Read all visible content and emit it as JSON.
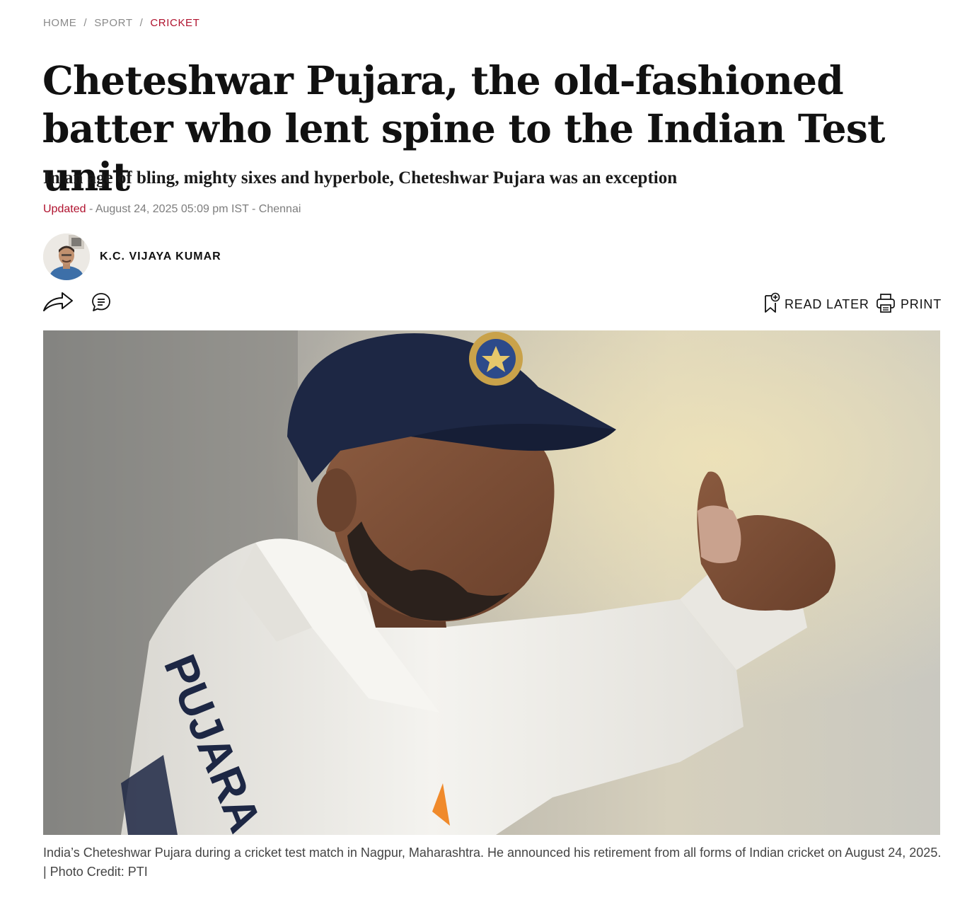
{
  "breadcrumb": {
    "home": "HOME",
    "sport": "SPORT",
    "cricket": "CRICKET",
    "separator": "/"
  },
  "article": {
    "title": "Cheteshwar Pujara, the old-fashioned batter who lent spine to the Indian Test unit",
    "subtitle": "In an age of bling, mighty sixes and hyperbole, Cheteshwar Pujara was an exception",
    "updated_label": "Updated",
    "dateline": " - August 24, 2025 05:09 pm IST - Chennai",
    "author": "K.C. VIJAYA KUMAR"
  },
  "toolbar": {
    "share_icon": "share-arrow-icon",
    "comment_icon": "comment-icon",
    "read_later_label": "READ LATER",
    "read_later_icon": "bookmark-plus-icon",
    "print_label": "PRINT",
    "print_icon": "printer-icon"
  },
  "hero_image": {
    "jersey_text": "PUJARA"
  },
  "caption": "India’s Cheteshwar Pujara during a cricket test match in Nagpur, Maharashtra. He announced his retirement from all forms of Indian cricket on August 24, 2025. | Photo Credit: PTI",
  "colors": {
    "accent": "#b0122e",
    "muted": "#8a8a8a",
    "text": "#111111"
  }
}
